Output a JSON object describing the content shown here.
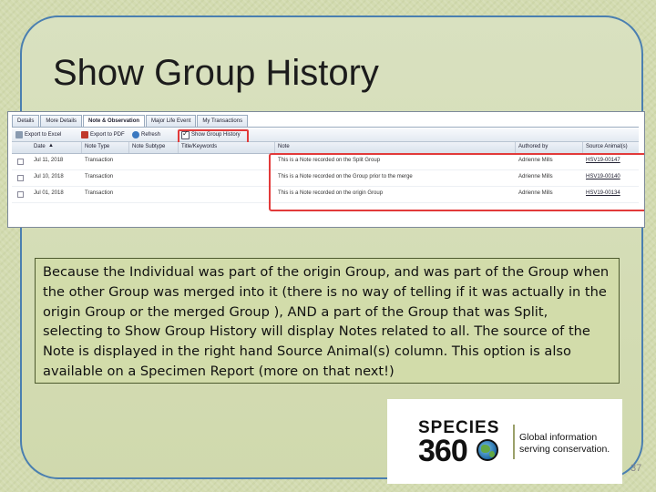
{
  "slide": {
    "title": "Show Group History",
    "page_number": "37",
    "caption": "Because the Individual was part of the origin Group, and was part of the Group when the other Group was merged into it (there is no way of telling if it was actually in the origin Group or the merged Group ), AND a part of the Group that was Split, selecting to Show Group History will display Notes related to all. The source of the Note is displayed in the right hand Source Animal(s) column. This option is also available on a Specimen Report (more on that next!)"
  },
  "screenshot": {
    "tabs": [
      "Details",
      "More Details",
      "Note & Observation",
      "Major Life Event",
      "My Transactions"
    ],
    "active_tab": "Note & Observation",
    "toolbar": {
      "export_excel": "Export to Excel",
      "export_pdf": "Export to PDF",
      "refresh": "Refresh",
      "show_group_history": "Show Group History"
    },
    "columns": [
      "Date",
      "Note Type",
      "Note Subtype",
      "Title/Keywords",
      "Note",
      "Authored by",
      "Source Animal(s)"
    ],
    "rows": [
      {
        "date": "Jul 11, 2018",
        "note_type": "Transaction",
        "note": "This is a Note recorded on the Split Group",
        "author": "Adrienne Mills",
        "source": "HSV19-00147"
      },
      {
        "date": "Jul 10, 2018",
        "note_type": "Transaction",
        "note": "This is a Note recorded on the Group prior to the merge",
        "author": "Adrienne Mills",
        "source": "HSV19-00140"
      },
      {
        "date": "Jul 01, 2018",
        "note_type": "Transaction",
        "note": "This is a Note recorded on the origin Group",
        "author": "Adrienne Mills",
        "source": "HSV19-00134"
      }
    ]
  },
  "logo": {
    "wordmark_top": "SPECIES",
    "wordmark_bottom": "360",
    "tagline_line1": "Global information",
    "tagline_line2": "serving conservation."
  },
  "colors": {
    "frame_border": "#4a7fb0",
    "highlight_red": "#e23a3a",
    "caption_bg": "#d2dcaa"
  }
}
